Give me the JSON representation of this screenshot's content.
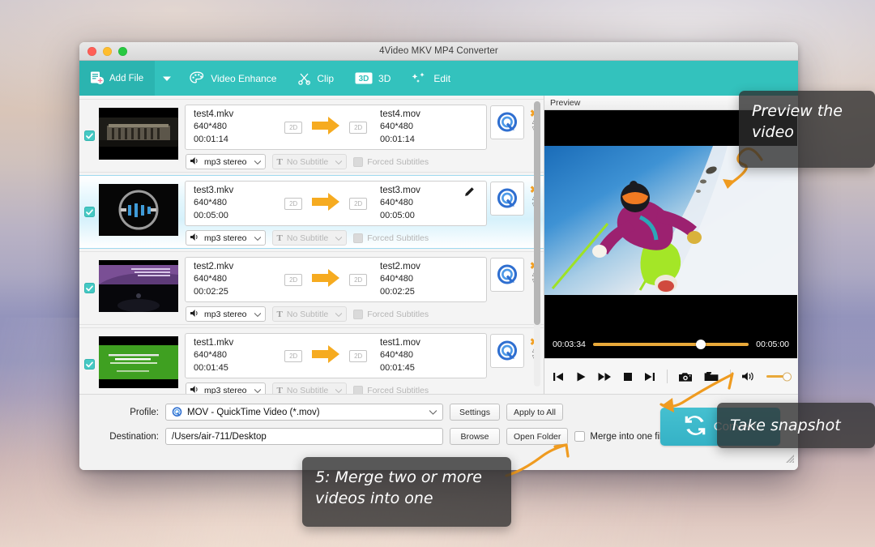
{
  "window": {
    "title": "4Video MKV MP4 Converter",
    "traffic_lights": [
      "close",
      "minimize",
      "maximize"
    ]
  },
  "toolbar": {
    "add_file": "Add File",
    "dropdown_caret": "chevron-down",
    "items": [
      {
        "label": "Video Enhance",
        "icon": "palette-icon"
      },
      {
        "label": "Clip",
        "icon": "scissors-icon"
      },
      {
        "label": "3D",
        "icon": "3d-icon"
      },
      {
        "label": "Edit",
        "icon": "sparkle-icon"
      }
    ]
  },
  "files": [
    {
      "checked": true,
      "selected": false,
      "source_name": "test4.mkv",
      "source_res": "640*480",
      "source_dur": "00:01:14",
      "badge_in": "2D",
      "badge_out": "2D",
      "target_name": "test4.mov",
      "target_res": "640*480",
      "target_dur": "00:01:14",
      "audio": "mp3 stereo",
      "subtitle": "No Subtitle",
      "forced": "Forced Subtitles",
      "has_pencil": false,
      "thumb": "white-house"
    },
    {
      "checked": true,
      "selected": true,
      "source_name": "test3.mkv",
      "source_res": "640*480",
      "source_dur": "00:05:00",
      "badge_in": "2D",
      "badge_out": "2D",
      "target_name": "test3.mov",
      "target_res": "640*480",
      "target_dur": "00:05:00",
      "audio": "mp3 stereo",
      "subtitle": "No Subtitle",
      "forced": "Forced Subtitles",
      "has_pencil": true,
      "thumb": "gopro-logo"
    },
    {
      "checked": true,
      "selected": false,
      "source_name": "test2.mkv",
      "source_res": "640*480",
      "source_dur": "00:02:25",
      "badge_in": "2D",
      "badge_out": "2D",
      "target_name": "test2.mov",
      "target_res": "640*480",
      "target_dur": "00:02:25",
      "audio": "mp3 stereo",
      "subtitle": "No Subtitle",
      "forced": "Forced Subtitles",
      "has_pencil": false,
      "thumb": "purple-stage"
    },
    {
      "checked": true,
      "selected": false,
      "source_name": "test1.mkv",
      "source_res": "640*480",
      "source_dur": "00:01:45",
      "badge_in": "2D",
      "badge_out": "2D",
      "target_name": "test1.mov",
      "target_res": "640*480",
      "target_dur": "00:01:45",
      "audio": "mp3 stereo",
      "subtitle": "No Subtitle",
      "forced": "Forced Subtitles",
      "has_pencil": false,
      "thumb": "green-card"
    }
  ],
  "preview": {
    "header": "Preview",
    "current_time": "00:03:34",
    "total_time": "00:05:00",
    "progress_percent": 69,
    "volume_percent": 100,
    "controls": [
      {
        "name": "previous",
        "glyph": "prev-icon"
      },
      {
        "name": "play",
        "glyph": "play-icon"
      },
      {
        "name": "fast-forward",
        "glyph": "forward-icon"
      },
      {
        "name": "stop",
        "glyph": "stop-icon"
      },
      {
        "name": "next",
        "glyph": "next-icon"
      },
      {
        "name": "snapshot",
        "glyph": "camera-icon"
      },
      {
        "name": "open-folder",
        "glyph": "folder-icon"
      }
    ]
  },
  "footer": {
    "profile_label": "Profile:",
    "profile_value": "MOV - QuickTime Video (*.mov)",
    "settings": "Settings",
    "apply_to_all": "Apply to All",
    "destination_label": "Destination:",
    "destination_value": "/Users/air-711/Desktop",
    "browse": "Browse",
    "open_folder": "Open Folder",
    "merge_label": "Merge into one file",
    "merge_checked": false,
    "convert": "Convert"
  },
  "callouts": {
    "preview_video": "Preview the video",
    "take_snapshot": "Take snapshot",
    "merge_videos": "5: Merge two or more videos into one"
  },
  "colors": {
    "toolbar_teal": "#33c2bd",
    "convert_teal": "#3dbac9",
    "accent_orange": "#e9a93a",
    "checkbox_teal": "#44c9c4",
    "selected_row_blue": "#d6f1fb"
  }
}
